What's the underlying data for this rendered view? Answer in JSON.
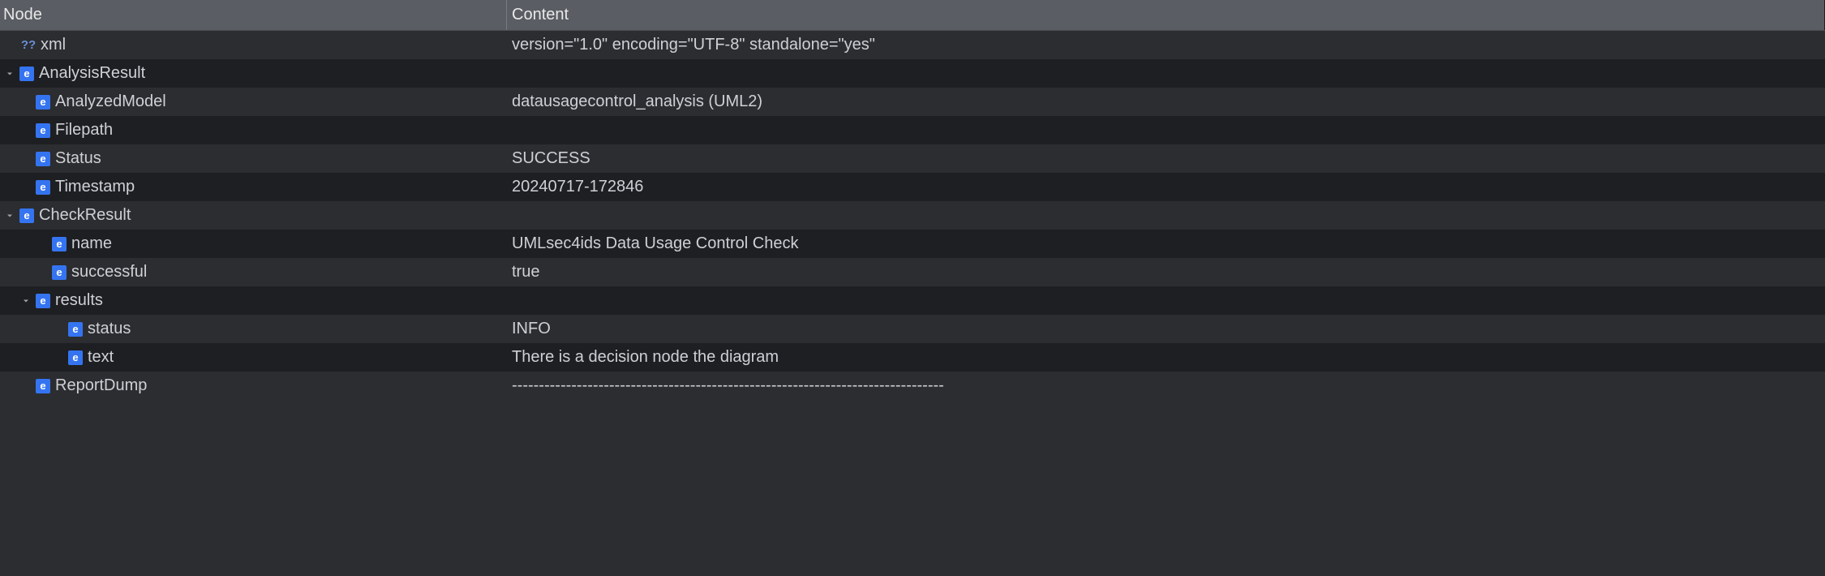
{
  "headers": {
    "node": "Node",
    "content": "Content"
  },
  "rows": [
    {
      "indent": 1,
      "arrow": null,
      "icon": "q",
      "label": "xml",
      "content": "version=\"1.0\" encoding=\"UTF-8\" standalone=\"yes\""
    },
    {
      "indent": 0,
      "arrow": "down",
      "icon": "e",
      "label": "AnalysisResult",
      "content": ""
    },
    {
      "indent": 2,
      "arrow": null,
      "icon": "e",
      "label": "AnalyzedModel",
      "content": "datausagecontrol_analysis (UML2)"
    },
    {
      "indent": 2,
      "arrow": null,
      "icon": "e",
      "label": "Filepath",
      "content": ""
    },
    {
      "indent": 2,
      "arrow": null,
      "icon": "e",
      "label": "Status",
      "content": "SUCCESS"
    },
    {
      "indent": 2,
      "arrow": null,
      "icon": "e",
      "label": "Timestamp",
      "content": "20240717-172846"
    },
    {
      "indent": 1,
      "arrow": "down",
      "icon": "e",
      "label": "CheckResult",
      "content": ""
    },
    {
      "indent": 3,
      "arrow": null,
      "icon": "e",
      "label": "name",
      "content": "UMLsec4ids Data Usage Control Check"
    },
    {
      "indent": 3,
      "arrow": null,
      "icon": "e",
      "label": "successful",
      "content": "true"
    },
    {
      "indent": 2,
      "arrow": "down",
      "icon": "e",
      "label": "results",
      "content": ""
    },
    {
      "indent": 4,
      "arrow": null,
      "icon": "e",
      "label": "status",
      "content": "INFO"
    },
    {
      "indent": 4,
      "arrow": null,
      "icon": "e",
      "label": "text",
      "content": "There is a decision node the diagram"
    },
    {
      "indent": 2,
      "arrow": null,
      "icon": "e",
      "label": "ReportDump",
      "content": "--------------------------------------------------------------------------------"
    }
  ]
}
